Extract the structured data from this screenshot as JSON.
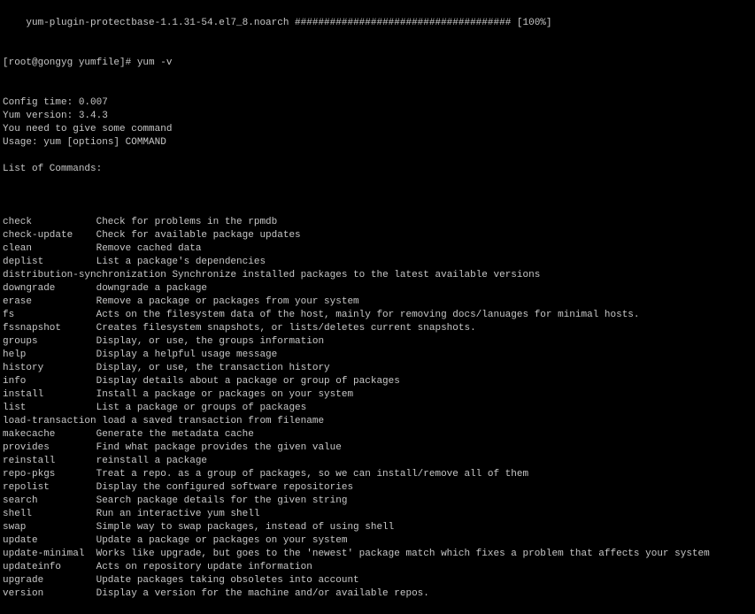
{
  "terminal": {
    "partial_top_line": "    yum-plugin-protectbase-1.1.31-54.el7_8.noarch ##################################### [100%]",
    "prompt": "[root@gongyg yumfile]# yum -v",
    "output": [
      "Config time: 0.007",
      "Yum version: 3.4.3",
      "You need to give some command",
      "Usage: yum [options] COMMAND",
      "",
      "List of Commands:",
      ""
    ],
    "commands": [
      {
        "name": "check",
        "desc": "Check for problems in the rpmdb"
      },
      {
        "name": "check-update",
        "desc": "Check for available package updates"
      },
      {
        "name": "clean",
        "desc": "Remove cached data"
      },
      {
        "name": "deplist",
        "desc": "List a package's dependencies"
      },
      {
        "name": "distribution-synchronization",
        "desc": "Synchronize installed packages to the latest available versions"
      },
      {
        "name": "downgrade",
        "desc": "downgrade a package"
      },
      {
        "name": "erase",
        "desc": "Remove a package or packages from your system"
      },
      {
        "name": "fs",
        "desc": "Acts on the filesystem data of the host, mainly for removing docs/lanuages for minimal hosts."
      },
      {
        "name": "fssnapshot",
        "desc": "Creates filesystem snapshots, or lists/deletes current snapshots."
      },
      {
        "name": "groups",
        "desc": "Display, or use, the groups information"
      },
      {
        "name": "help",
        "desc": "Display a helpful usage message"
      },
      {
        "name": "history",
        "desc": "Display, or use, the transaction history"
      },
      {
        "name": "info",
        "desc": "Display details about a package or group of packages"
      },
      {
        "name": "install",
        "desc": "Install a package or packages on your system"
      },
      {
        "name": "list",
        "desc": "List a package or groups of packages"
      },
      {
        "name": "load-transaction",
        "desc": "load a saved transaction from filename"
      },
      {
        "name": "makecache",
        "desc": "Generate the metadata cache"
      },
      {
        "name": "provides",
        "desc": "Find what package provides the given value"
      },
      {
        "name": "reinstall",
        "desc": "reinstall a package"
      },
      {
        "name": "repo-pkgs",
        "desc": "Treat a repo. as a group of packages, so we can install/remove all of them"
      },
      {
        "name": "repolist",
        "desc": "Display the configured software repositories"
      },
      {
        "name": "search",
        "desc": "Search package details for the given string"
      },
      {
        "name": "shell",
        "desc": "Run an interactive yum shell"
      },
      {
        "name": "swap",
        "desc": "Simple way to swap packages, instead of using shell"
      },
      {
        "name": "update",
        "desc": "Update a package or packages on your system"
      },
      {
        "name": "update-minimal",
        "desc": "Works like upgrade, but goes to the 'newest' package match which fixes a problem that affects your system"
      },
      {
        "name": "updateinfo",
        "desc": "Acts on repository update information"
      },
      {
        "name": "upgrade",
        "desc": "Update packages taking obsoletes into account"
      },
      {
        "name": "version",
        "desc": "Display a version for the machine and/or available repos."
      }
    ]
  }
}
